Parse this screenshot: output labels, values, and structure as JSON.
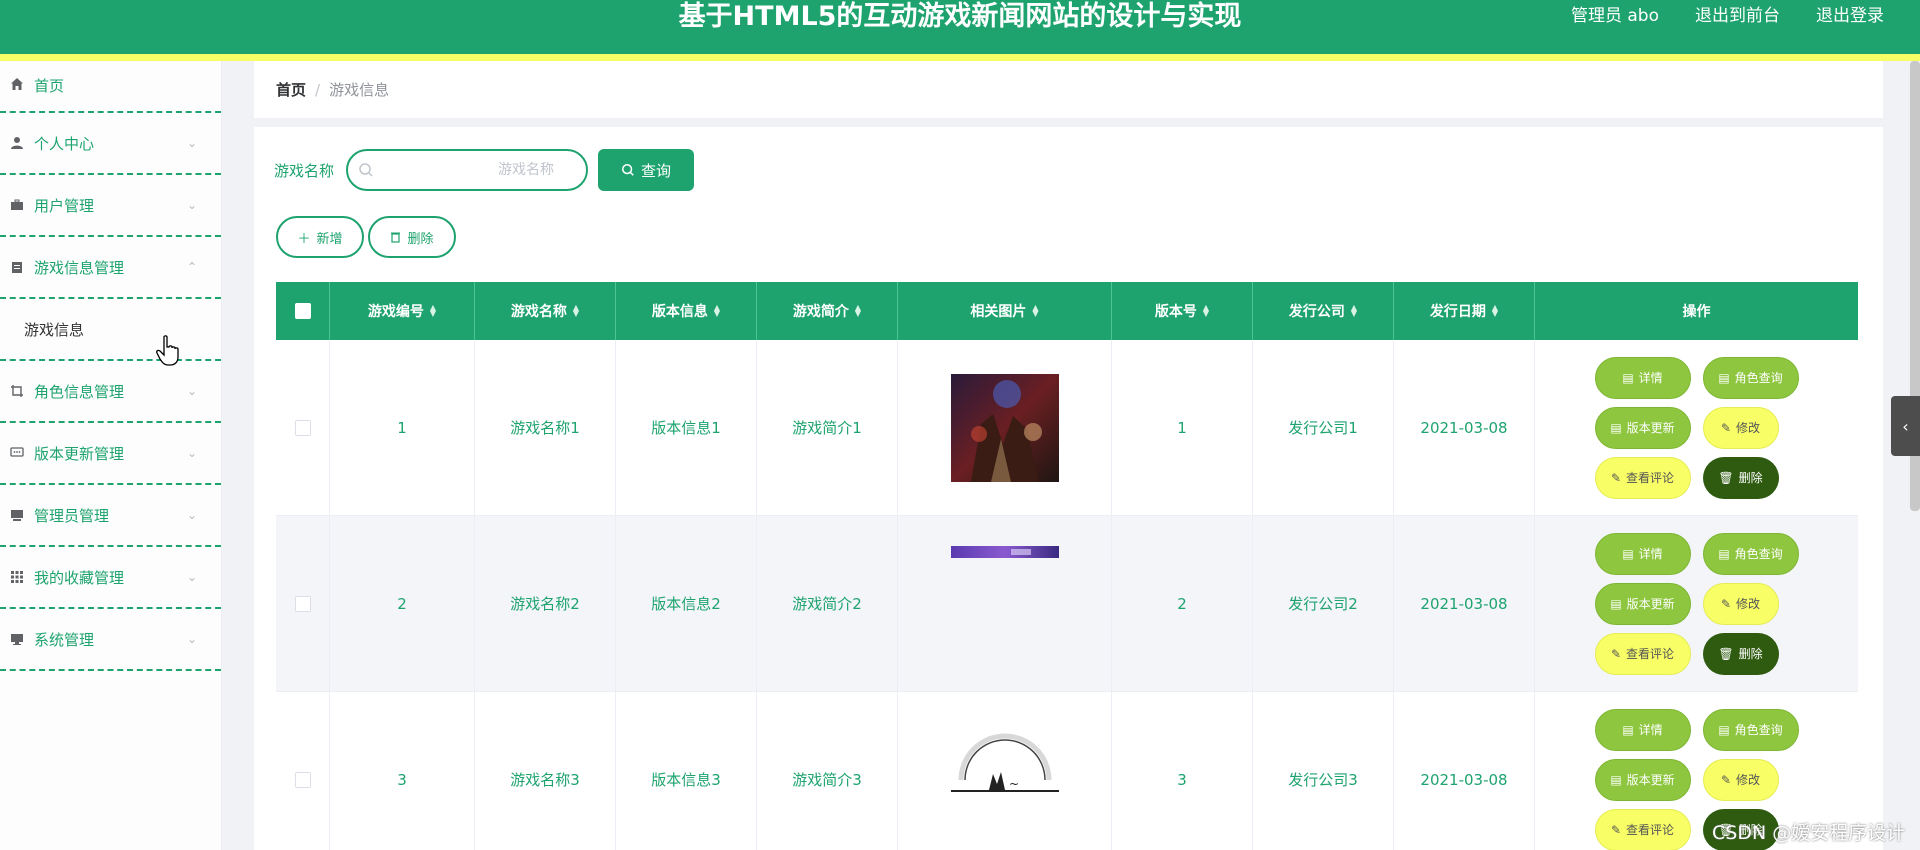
{
  "header": {
    "title": "基于HTML5的互动游戏新闻网站的设计与实现",
    "admin": "管理员 abo",
    "to_front": "退出到前台",
    "logout": "退出登录"
  },
  "sidebar": {
    "items": [
      {
        "label": "首页",
        "icon": "home-icon"
      },
      {
        "label": "个人中心",
        "icon": "user-icon"
      },
      {
        "label": "用户管理",
        "icon": "briefcase-icon"
      },
      {
        "label": "游戏信息管理",
        "icon": "clipboard-icon",
        "expanded": true
      },
      {
        "label": "角色信息管理",
        "icon": "crop-icon"
      },
      {
        "label": "版本更新管理",
        "icon": "chat-icon"
      },
      {
        "label": "管理员管理",
        "icon": "monitor-icon"
      },
      {
        "label": "我的收藏管理",
        "icon": "grid-icon"
      },
      {
        "label": "系统管理",
        "icon": "desktop-icon"
      }
    ],
    "sub_item": "游戏信息"
  },
  "breadcrumb": {
    "home": "首页",
    "sep": "/",
    "current": "游戏信息"
  },
  "search": {
    "label": "游戏名称",
    "placeholder": "游戏名称",
    "button": "查询"
  },
  "actions": {
    "add": "新增",
    "delete": "删除"
  },
  "table": {
    "headers": [
      "游戏编号",
      "游戏名称",
      "版本信息",
      "游戏简介",
      "相关图片",
      "版本号",
      "发行公司",
      "发行日期",
      "操作"
    ],
    "rows": [
      {
        "id": "1",
        "name": "游戏名称1",
        "version_info": "版本信息1",
        "intro": "游戏简介1",
        "version_no": "1",
        "company": "发行公司1",
        "date": "2021-03-08"
      },
      {
        "id": "2",
        "name": "游戏名称2",
        "version_info": "版本信息2",
        "intro": "游戏简介2",
        "version_no": "2",
        "company": "发行公司2",
        "date": "2021-03-08"
      },
      {
        "id": "3",
        "name": "游戏名称3",
        "version_info": "版本信息3",
        "intro": "游戏简介3",
        "version_no": "3",
        "company": "发行公司3",
        "date": "2021-03-08"
      }
    ],
    "ops": {
      "detail": "详情",
      "role_query": "角色查询",
      "version_update": "版本更新",
      "edit": "修改",
      "view_comments": "查看评论",
      "delete": "删除"
    }
  },
  "watermark": "CSDN @嫒安程序设计",
  "colors": {
    "primary": "#1ea36f",
    "accent_yellow": "#f8ff66",
    "lime": "#8ec63f",
    "dark_green": "#2e5b0f"
  }
}
